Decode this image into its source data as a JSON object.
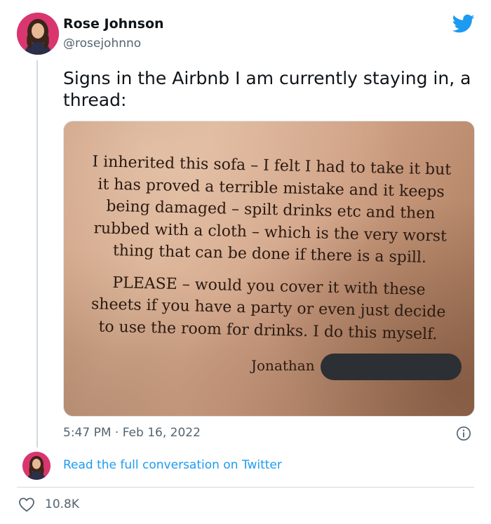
{
  "author": {
    "name": "Rose Johnson",
    "handle": "@rosejohnno"
  },
  "tweet": {
    "text": "Signs in the Airbnb I am currently staying in, a thread:",
    "timestamp": "5:47 PM · Feb 16, 2022",
    "likes": "10.8K"
  },
  "photo_sign": {
    "paragraph1": [
      "I inherited this sofa – I felt I had to take it but",
      "it has proved a terrible mistake and it keeps",
      "being damaged – spilt drinks etc and then",
      "rubbed with a cloth – which is the very worst",
      "thing that can be done if there is a spill."
    ],
    "paragraph2": [
      "PLEASE – would you cover it with these",
      "sheets if you have a party or even just decide",
      "to use the room for drinks.  I do this myself."
    ],
    "signature": "Jonathan"
  },
  "links": {
    "read_conversation": "Read the full conversation on Twitter"
  },
  "icons": {
    "brand": "twitter-bird-icon",
    "info": "info-icon",
    "like": "heart-icon"
  },
  "colors": {
    "twitter_blue": "#1d9bf0",
    "secondary_text": "#536471",
    "avatar_bg": "#d9366f"
  }
}
